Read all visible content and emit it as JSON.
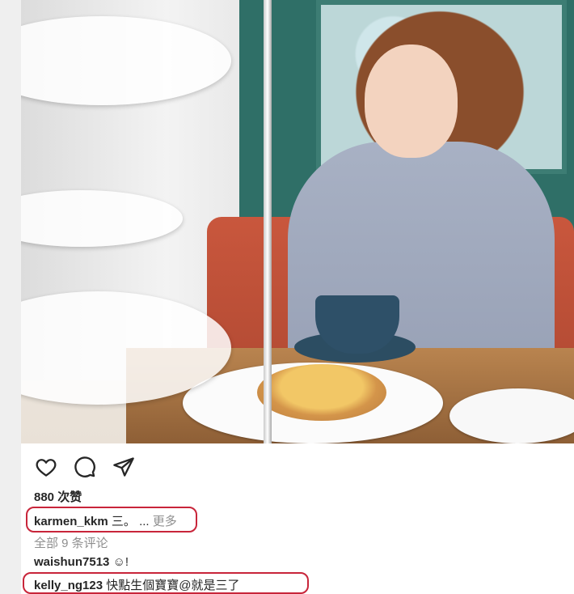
{
  "post": {
    "photo_alt": "",
    "likes": "880 次赞",
    "caption": {
      "username": "karmen_kkm",
      "text": "三。",
      "ellipsis": "...",
      "more": "更多"
    },
    "view_all_comments": "全部 9 条评论",
    "comments": [
      {
        "username": "waishun7513",
        "text": "☺!"
      },
      {
        "username": "kelly_ng123",
        "text": "快點生個寶寶@就是三了"
      }
    ]
  },
  "actions": [
    {
      "icon": "heart-icon"
    },
    {
      "icon": "comment-icon"
    },
    {
      "icon": "share-icon"
    }
  ],
  "colors": {
    "highlight": "#c8253a",
    "muted": "#8e8e8e",
    "text": "#262626"
  }
}
